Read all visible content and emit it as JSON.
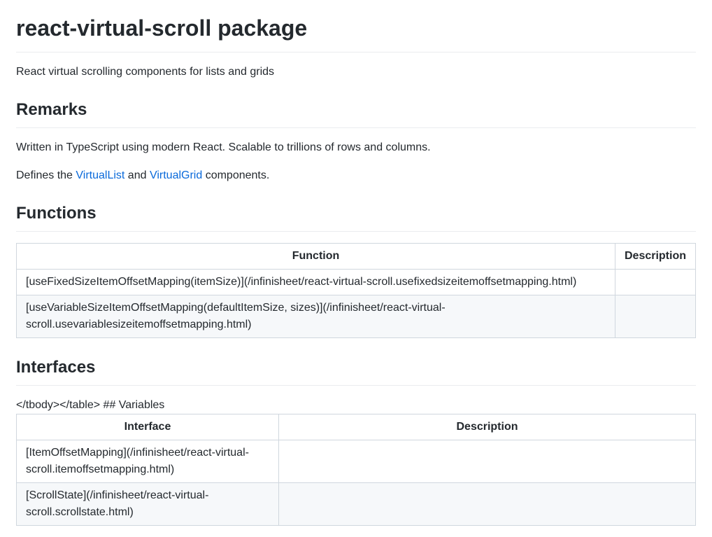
{
  "title": "react-virtual-scroll package",
  "intro": "React virtual scrolling components for lists and grids",
  "remarks": {
    "heading": "Remarks",
    "line1": "Written in TypeScript using modern React. Scalable to trillions of rows and columns.",
    "defines_prefix": "Defines the ",
    "link1": "VirtualList",
    "between": " and ",
    "link2": "VirtualGrid",
    "defines_suffix": " components."
  },
  "functions": {
    "heading": "Functions",
    "col1": "Function",
    "col2": "Description",
    "rows": [
      {
        "text": "[useFixedSizeItemOffsetMapping(itemSize)](/infinisheet/react-virtual-scroll.usefixedsizeitemoffsetmapping.html)",
        "desc": ""
      },
      {
        "text": "[useVariableSizeItemOffsetMapping(defaultItemSize, sizes)](/infinisheet/react-virtual-scroll.usevariablesizeitemoffsetmapping.html)",
        "desc": ""
      }
    ]
  },
  "interfaces": {
    "heading": "Interfaces",
    "stray_text": "</tbody></table> ## Variables",
    "col1": "Interface",
    "col2": "Description",
    "rows": [
      {
        "text": "[ItemOffsetMapping](/infinisheet/react-virtual-scroll.itemoffsetmapping.html)",
        "desc": ""
      },
      {
        "text": "[ScrollState](/infinisheet/react-virtual-scroll.scrollstate.html)",
        "desc": ""
      }
    ]
  }
}
